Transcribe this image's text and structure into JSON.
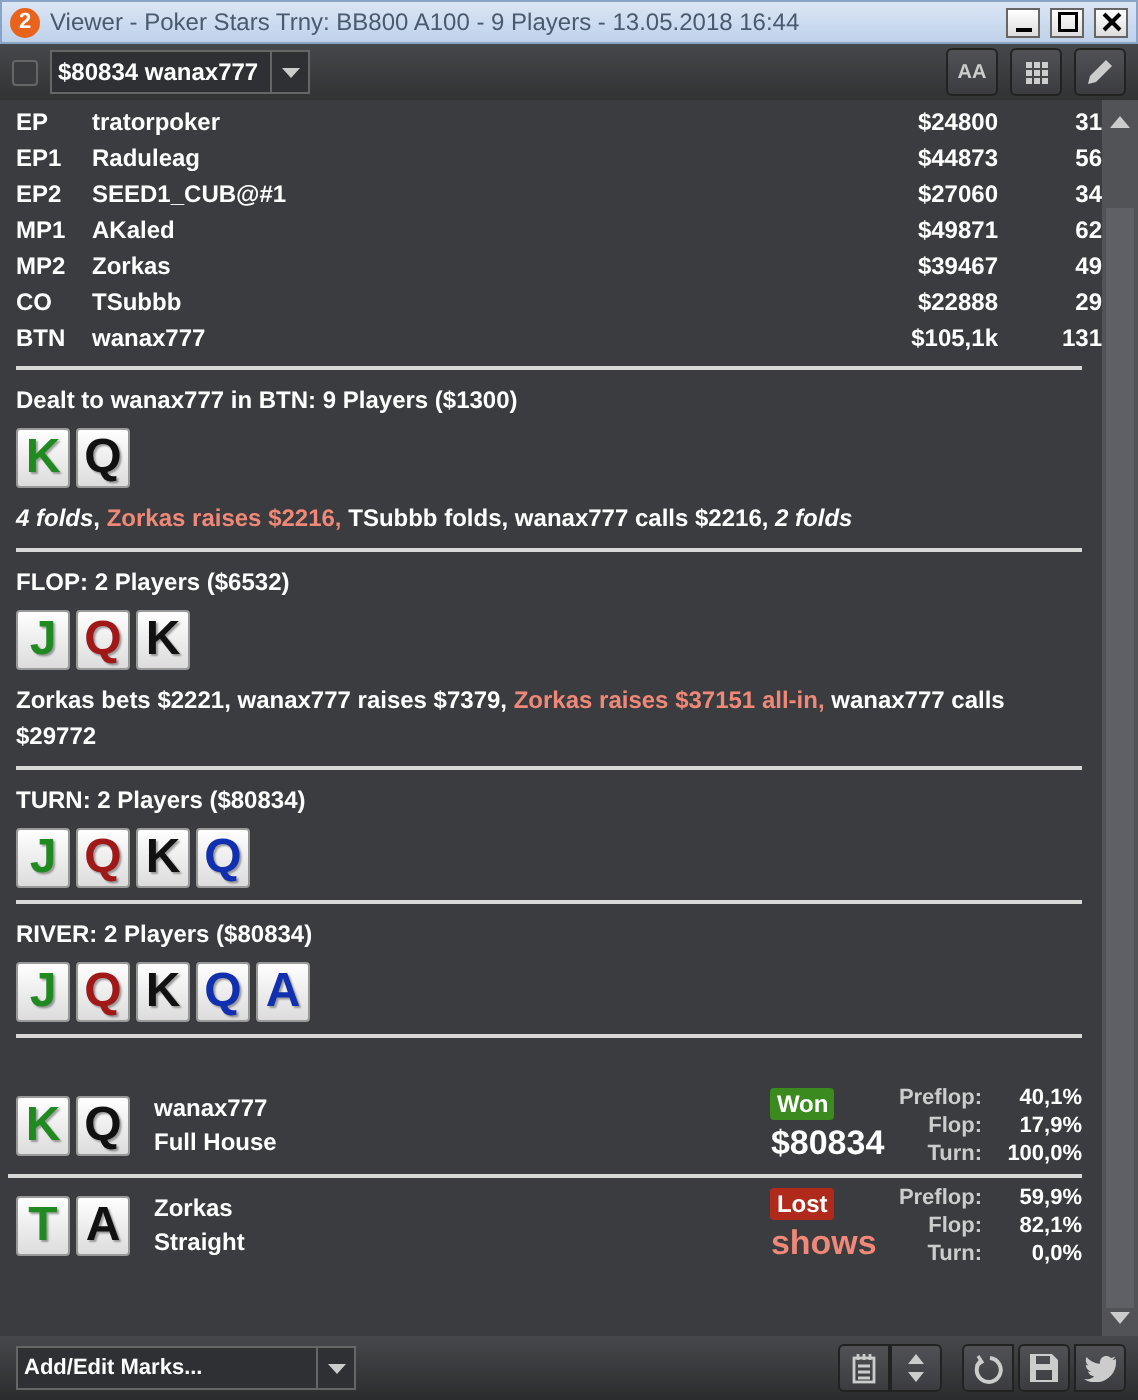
{
  "window": {
    "badge": "2",
    "title": "Viewer - Poker Stars Trny: BB800 A100 - 9 Players - 13.05.2018 16:44"
  },
  "toolbar": {
    "checkbox": {
      "checked": false
    },
    "hand_select": {
      "value": "$80834 wanax777"
    },
    "font_button": "AA"
  },
  "players": [
    {
      "position": "EP",
      "name": "tratorpoker",
      "stack": "$24800",
      "column_4": "31"
    },
    {
      "position": "EP1",
      "name": "Raduleag",
      "stack": "$44873",
      "column_4": "56"
    },
    {
      "position": "EP2",
      "name": "SEED1_CUB@#1",
      "stack": "$27060",
      "column_4": "34"
    },
    {
      "position": "MP1",
      "name": "AKaled",
      "stack": "$49871",
      "column_4": "62"
    },
    {
      "position": "MP2",
      "name": "Zorkas",
      "stack": "$39467",
      "column_4": "49"
    },
    {
      "position": "CO",
      "name": "TSubbb",
      "stack": "$22888",
      "column_4": "29"
    },
    {
      "position": "BTN",
      "name": "wanax777",
      "stack": "$105,1k",
      "column_4": "131"
    }
  ],
  "streets": [
    {
      "header": "Dealt to wanax777 in BTN: 9 Players ($1300)",
      "cards": [
        {
          "rank": "K",
          "color": "#1f8a1f"
        },
        {
          "rank": "Q",
          "color": "#111111"
        }
      ],
      "actions": [
        {
          "kind": "fold",
          "text": "4 folds"
        },
        {
          "kind": "plain",
          "text": ", "
        },
        {
          "kind": "raise",
          "text": "Zorkas raises $2216, "
        },
        {
          "kind": "plain",
          "text": "TSubbb folds, wanax777 calls $2216, "
        },
        {
          "kind": "fold",
          "text": "2 folds"
        }
      ]
    },
    {
      "header": "FLOP: 2 Players ($6532)",
      "cards": [
        {
          "rank": "J",
          "color": "#1f8a1f"
        },
        {
          "rank": "Q",
          "color": "#a01818"
        },
        {
          "rank": "K",
          "color": "#111111"
        }
      ],
      "actions": [
        {
          "kind": "plain",
          "text": "Zorkas bets $2221, wanax777 raises $7379, "
        },
        {
          "kind": "raise",
          "text": "Zorkas raises $37151 all-in, "
        },
        {
          "kind": "plain",
          "text": "wanax777 calls $29772"
        }
      ]
    },
    {
      "header": "TURN: 2 Players ($80834)",
      "cards": [
        {
          "rank": "J",
          "color": "#1f8a1f"
        },
        {
          "rank": "Q",
          "color": "#a01818"
        },
        {
          "rank": "K",
          "color": "#111111"
        },
        {
          "rank": "Q",
          "color": "#1030b0"
        }
      ]
    },
    {
      "header": "RIVER: 2 Players ($80834)",
      "cards": [
        {
          "rank": "J",
          "color": "#1f8a1f"
        },
        {
          "rank": "Q",
          "color": "#a01818"
        },
        {
          "rank": "K",
          "color": "#111111"
        },
        {
          "rank": "Q",
          "color": "#1030b0"
        },
        {
          "rank": "A",
          "color": "#1030b0"
        }
      ]
    }
  ],
  "results": [
    {
      "cards": [
        {
          "rank": "K",
          "color": "#1f8a1f"
        },
        {
          "rank": "Q",
          "color": "#111111"
        }
      ],
      "name": "wanax777",
      "hand": "Full House",
      "outcome": {
        "kind": "won",
        "label": "Won"
      },
      "amount": "$80834",
      "equity": [
        {
          "label": "Preflop:",
          "value": "40,1%"
        },
        {
          "label": "Flop:",
          "value": "17,9%"
        },
        {
          "label": "Turn:",
          "value": "100,0%"
        }
      ]
    },
    {
      "cards": [
        {
          "rank": "T",
          "color": "#1f8a1f"
        },
        {
          "rank": "A",
          "color": "#111111"
        }
      ],
      "name": "Zorkas",
      "hand": "Straight",
      "outcome": {
        "kind": "lost",
        "label": "Lost"
      },
      "amount": "shows",
      "equity": [
        {
          "label": "Preflop:",
          "value": "59,9%"
        },
        {
          "label": "Flop:",
          "value": "82,1%"
        },
        {
          "label": "Turn:",
          "value": "0,0%"
        }
      ]
    }
  ],
  "bottom_bar": {
    "marks_select": {
      "value": "Add/Edit Marks..."
    }
  }
}
